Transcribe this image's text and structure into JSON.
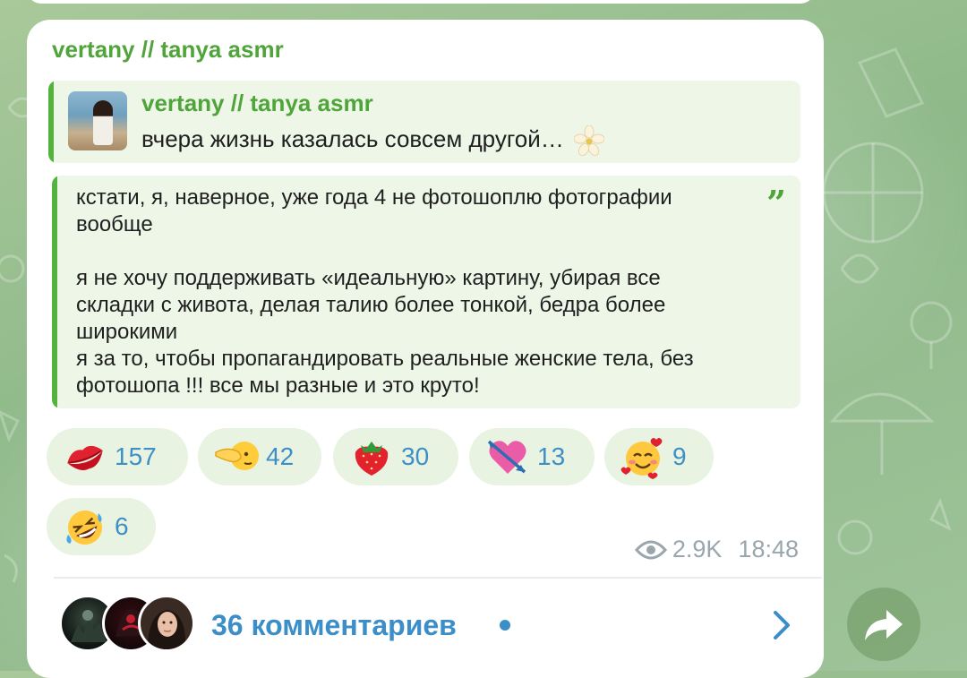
{
  "channel": {
    "name": "vertany // tanya asmr"
  },
  "reply": {
    "name": "vertany // tanya asmr",
    "text": "вчера жизнь казалась совсем  другой…"
  },
  "quote": {
    "text": "кстати, я, наверное, уже года 4 не фотошоплю фотографии вообще\n\nя не хочу поддерживать «идеальную» картину, убирая все складки с живота, делая талию более тонкой, бедра более широкими\nя за то, чтобы пропагандировать реальные женские тела, без фотошопа !!! все мы разные и это круто!",
    "mark": "”"
  },
  "reactions": [
    {
      "icon": "kiss-lips-icon",
      "count": "157"
    },
    {
      "icon": "pointing-hand-icon",
      "count": "42"
    },
    {
      "icon": "strawberry-icon",
      "count": "30"
    },
    {
      "icon": "heart-arrow-icon",
      "count": "13"
    },
    {
      "icon": "smiling-face-hearts-icon",
      "count": "9"
    },
    {
      "icon": "rofl-icon",
      "count": "6"
    }
  ],
  "meta": {
    "views": "2.9K",
    "time": "18:48"
  },
  "comments": {
    "label": "36 комментариев"
  },
  "colors": {
    "accent_green": "#4fa43a",
    "link_blue": "#3b8ec8",
    "reaction_bg": "#e8f3e2",
    "quote_bg": "#edf6e7"
  }
}
